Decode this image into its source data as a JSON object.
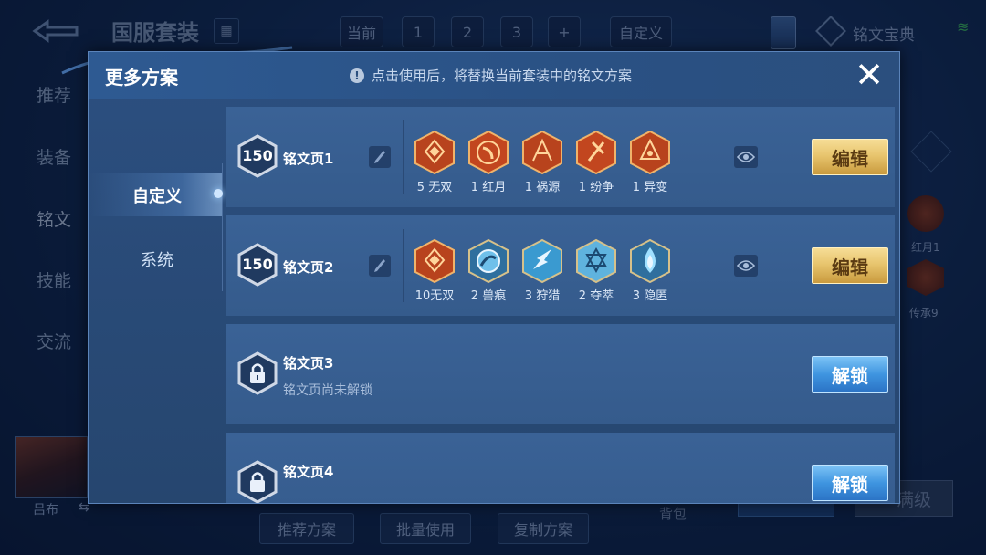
{
  "background": {
    "header_title": "国服套装",
    "top_tabs": [
      "当前",
      "1",
      "2",
      "3",
      "+",
      "自定义"
    ],
    "top_right_label": "铭文宝典",
    "left_tabs": [
      "推荐",
      "装备",
      "铭文",
      "技能",
      "交流"
    ],
    "hero_name": "吕布",
    "bottom_buttons": [
      "推荐方案",
      "批量使用",
      "复制方案"
    ],
    "bag_label": "背包",
    "max_level_label": "满级",
    "side_runes": [
      "红月1",
      "传承9"
    ]
  },
  "modal": {
    "title": "更多方案",
    "notice": "点击使用后，将替换当前套装中的铭文方案",
    "info_icon": "!",
    "close_icon": "✕",
    "sidebar": [
      {
        "label": "自定义",
        "active": true
      },
      {
        "label": "系统",
        "active": false
      }
    ],
    "pages": [
      {
        "level": "150",
        "name": "铭文页1",
        "locked": false,
        "action": "编辑",
        "runes": [
          {
            "label": "5 无双",
            "color": "red",
            "icon": "wushuang-rune-icon"
          },
          {
            "label": "1 红月",
            "color": "red",
            "icon": "hongyue-rune-icon"
          },
          {
            "label": "1 祸源",
            "color": "red",
            "icon": "huoyuan-rune-icon"
          },
          {
            "label": "1 纷争",
            "color": "red",
            "icon": "fenzheng-rune-icon"
          },
          {
            "label": "1 异变",
            "color": "red",
            "icon": "yibian-rune-icon"
          }
        ]
      },
      {
        "level": "150",
        "name": "铭文页2",
        "locked": false,
        "action": "编辑",
        "runes": [
          {
            "label": "10无双",
            "color": "red",
            "icon": "wushuang-rune-icon"
          },
          {
            "label": "2 兽痕",
            "color": "blue",
            "icon": "shouhen-rune-icon"
          },
          {
            "label": "3 狩猎",
            "color": "blue",
            "icon": "shoulie-rune-icon"
          },
          {
            "label": "2 夺萃",
            "color": "blue",
            "icon": "duocui-rune-icon"
          },
          {
            "label": "3 隐匿",
            "color": "blue",
            "icon": "yinni-rune-icon"
          }
        ]
      },
      {
        "name": "铭文页3",
        "locked": true,
        "status": "铭文页尚未解锁",
        "action": "解锁"
      },
      {
        "name": "铭文页4",
        "locked": true,
        "action": "解锁"
      }
    ]
  },
  "colors": {
    "red_rune": "#c0471f",
    "blue_rune": "#3a9ad0",
    "gold_button": "#e8c56e",
    "blue_button": "#3f95e0"
  }
}
